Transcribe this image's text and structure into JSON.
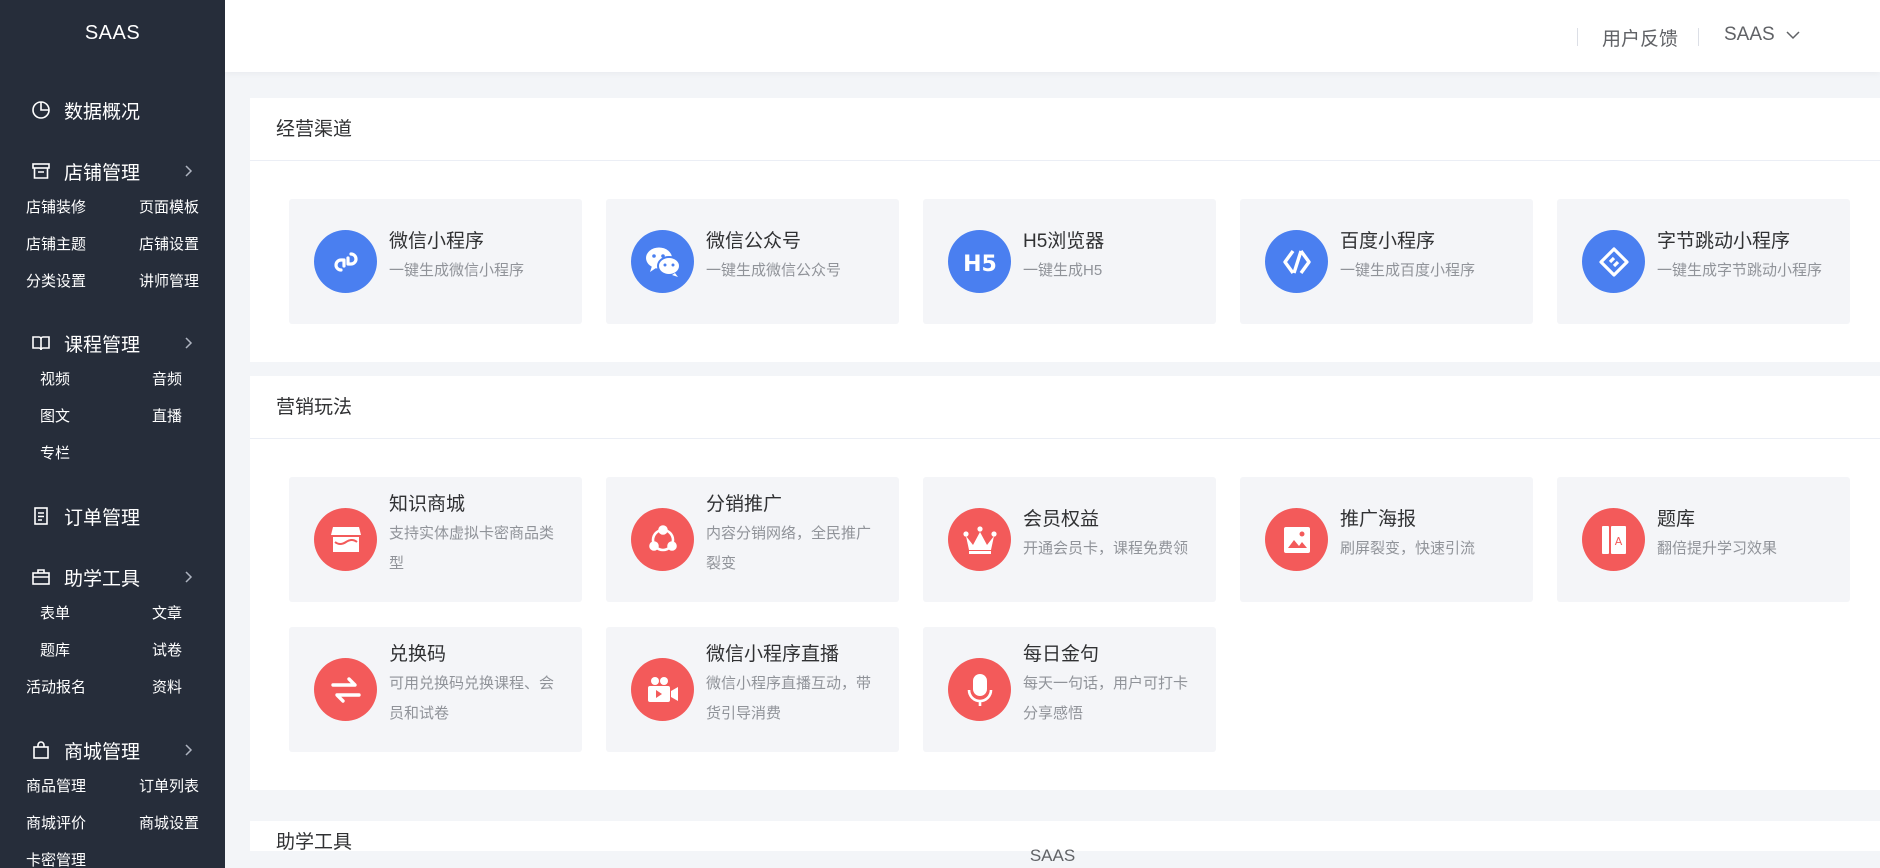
{
  "app": {
    "logo": "SAAS",
    "footer": "SAAS"
  },
  "header": {
    "feedback": "用户反馈",
    "account": "SAAS"
  },
  "sidebar": {
    "overview": "数据概况",
    "store": {
      "title": "店铺管理",
      "items": [
        "店铺装修",
        "页面模板",
        "店铺主题",
        "店铺设置",
        "分类设置",
        "讲师管理"
      ]
    },
    "course": {
      "title": "课程管理",
      "items": [
        "视频",
        "音频",
        "图文",
        "直播",
        "专栏"
      ]
    },
    "orders": "订单管理",
    "tools": {
      "title": "助学工具",
      "items": [
        "表单",
        "文章",
        "题库",
        "试卷",
        "活动报名",
        "资料"
      ]
    },
    "mall": {
      "title": "商城管理",
      "items": [
        "商品管理",
        "订单列表",
        "商城评价",
        "商城设置",
        "卡密管理"
      ]
    }
  },
  "channels": {
    "title": "经营渠道",
    "cards": [
      {
        "title": "微信小程序",
        "desc": "一键生成微信小程序",
        "icon": "mini-program-icon"
      },
      {
        "title": "微信公众号",
        "desc": "一键生成微信公众号",
        "icon": "wechat-icon"
      },
      {
        "title": "H5浏览器",
        "desc": "一键生成H5",
        "icon": "h5-icon"
      },
      {
        "title": "百度小程序",
        "desc": "一键生成百度小程序",
        "icon": "baidu-icon"
      },
      {
        "title": "字节跳动小程序",
        "desc": "一键生成字节跳动小程序",
        "icon": "bytedance-icon"
      }
    ]
  },
  "marketing": {
    "title": "营销玩法",
    "cards": [
      {
        "title": "知识商城",
        "desc": "支持实体虚拟卡密商品类型",
        "icon": "store-icon"
      },
      {
        "title": "分销推广",
        "desc": "内容分销网络，全民推广裂变",
        "icon": "share-icon"
      },
      {
        "title": "会员权益",
        "desc": "开通会员卡，课程免费领",
        "icon": "crown-icon"
      },
      {
        "title": "推广海报",
        "desc": "刷屏裂变，快速引流",
        "icon": "poster-icon"
      },
      {
        "title": "题库",
        "desc": "翻倍提升学习效果",
        "icon": "question-bank-icon"
      },
      {
        "title": "兑换码",
        "desc": "可用兑换码兑换课程、会员和试卷",
        "icon": "exchange-icon"
      },
      {
        "title": "微信小程序直播",
        "desc": "微信小程序直播互动，带货引导消费",
        "icon": "live-camera-icon"
      },
      {
        "title": "每日金句",
        "desc": "每天一句话，用户可打卡分享感悟",
        "icon": "microphone-icon"
      }
    ]
  },
  "next_section": {
    "title": "助学工具"
  },
  "colors": {
    "sidebar": "#262d3a",
    "blue": "#4a7ff0",
    "red": "#f35a5a",
    "card": "#f4f5f8"
  }
}
